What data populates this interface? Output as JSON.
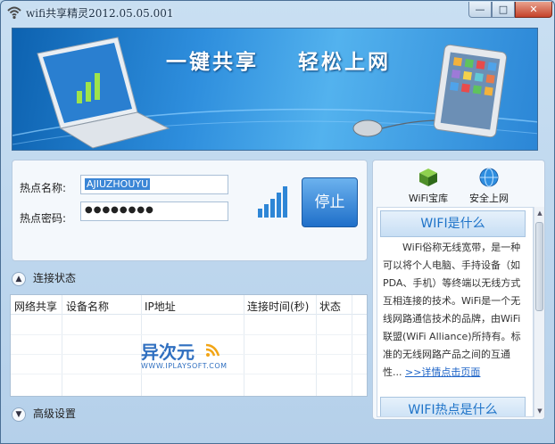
{
  "window": {
    "title": "wifi共享精灵2012.05.05.001",
    "buttons": {
      "minimize": "—",
      "maximize": "□",
      "close": "✕"
    }
  },
  "banner": {
    "slogan": "一键共享    轻松上网"
  },
  "hotspot": {
    "name_label": "热点名称:",
    "name_value": "AJIUZHOUYU",
    "password_label": "热点密码:",
    "password_value": "●●●●●●●●",
    "stop_button": "停止",
    "signal_icon": "signal-bars-icon"
  },
  "connection": {
    "section_title": "连接状态",
    "columns": [
      "网络共享",
      "设备名称",
      "IP地址",
      "连接时间(秒)",
      "状态"
    ],
    "rows": []
  },
  "watermark": {
    "text": "异次元",
    "sub": "WWW.IPLAYSOFT.COM"
  },
  "advanced": {
    "section_title": "高级设置"
  },
  "sidebar": {
    "tools": [
      {
        "label": "WiFi宝库",
        "icon": "treasure-box-icon"
      },
      {
        "label": "安全上网",
        "icon": "globe-icon"
      }
    ],
    "info": {
      "title": "WIFI是什么",
      "body": "WiFi俗称无线宽带，是一种可以将个人电脑、手持设备（如PDA、手机）等终端以无线方式互相连接的技术。WiFi是一个无线网路通信技术的品牌，由WiFi联盟(WiFi Alliance)所持有。标准的无线网路产品之间的互通性...",
      "more_link": ">>详情点击页面",
      "next_title": "WIFI热点是什么"
    }
  },
  "colors": {
    "accent": "#1f6fc9",
    "link": "#1c63c7",
    "banner": "#2e8edd"
  }
}
